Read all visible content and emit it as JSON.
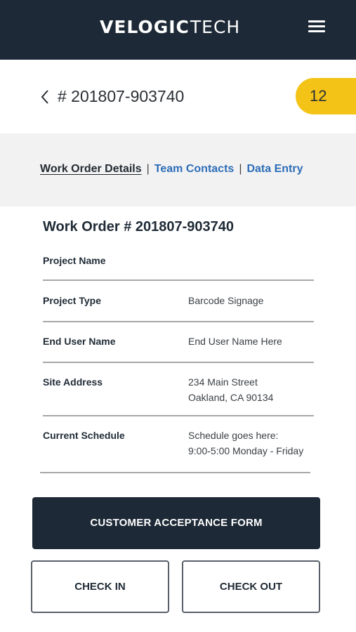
{
  "header": {
    "brand_bold": "VELOGIC",
    "brand_light": "TECH",
    "menu_icon": "hamburger-menu-icon"
  },
  "order_bar": {
    "back_icon": "chevron-left-icon",
    "title": "# 201807-903740",
    "badge_count": "12"
  },
  "tabs": {
    "items": [
      {
        "label": "Work Order Details",
        "active": true
      },
      {
        "label": "Team Contacts",
        "active": false
      },
      {
        "label": "Data Entry",
        "active": false
      }
    ],
    "separator": "|"
  },
  "details": {
    "heading": "Work Order # 201807-903740",
    "rows": [
      {
        "label": "Project Name",
        "value_line1": "",
        "value_line2": ""
      },
      {
        "label": "Project Type",
        "value_line1": "Barcode Signage",
        "value_line2": ""
      },
      {
        "label": "End User Name",
        "value_line1": "End User Name Here",
        "value_line2": ""
      },
      {
        "label": "Site Address",
        "value_line1": "234 Main Street",
        "value_line2": "Oakland, CA 90134"
      },
      {
        "label": "Current Schedule",
        "value_line1": "Schedule goes here:",
        "value_line2": "9:00-5:00 Monday - Friday"
      }
    ]
  },
  "actions": {
    "primary": "CUSTOMER ACCEPTANCE FORM",
    "check_in": "CHECK IN",
    "check_out": "CHECK OUT"
  },
  "colors": {
    "navy": "#1d2936",
    "accent_yellow": "#f4c318",
    "link_blue": "#2e6db7"
  }
}
